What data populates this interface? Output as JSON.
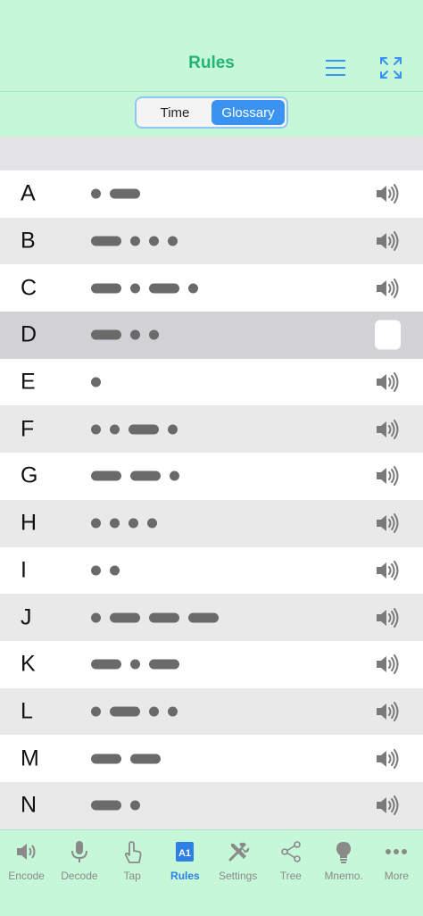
{
  "nav": {
    "title": "Rules"
  },
  "segments": {
    "time": "Time",
    "glossary": "Glossary",
    "selected": "Glossary"
  },
  "letters": [
    {
      "letter": "A",
      "code": ".-"
    },
    {
      "letter": "B",
      "code": "-..."
    },
    {
      "letter": "C",
      "code": "-.-."
    },
    {
      "letter": "D",
      "code": "-.."
    },
    {
      "letter": "E",
      "code": "."
    },
    {
      "letter": "F",
      "code": "..-."
    },
    {
      "letter": "G",
      "code": "--."
    },
    {
      "letter": "H",
      "code": "...."
    },
    {
      "letter": "I",
      "code": ".."
    },
    {
      "letter": "J",
      "code": ".---"
    },
    {
      "letter": "K",
      "code": "-.-"
    },
    {
      "letter": "L",
      "code": ".-.."
    },
    {
      "letter": "M",
      "code": "--"
    },
    {
      "letter": "N",
      "code": "-."
    }
  ],
  "selected_letter": "D",
  "tabs": [
    {
      "label": "Encode",
      "icon": "speaker-icon"
    },
    {
      "label": "Decode",
      "icon": "microphone-icon"
    },
    {
      "label": "Tap",
      "icon": "hand-tap-icon"
    },
    {
      "label": "Rules",
      "icon": "a1-icon",
      "active": true
    },
    {
      "label": "Settings",
      "icon": "tools-icon"
    },
    {
      "label": "Tree",
      "icon": "share-tree-icon"
    },
    {
      "label": "Mnemo.",
      "icon": "lightbulb-icon"
    },
    {
      "label": "More",
      "icon": "more-dots-icon"
    }
  ],
  "colors": {
    "header_bg": "#c6f7d9",
    "title_green": "#25b573",
    "accent_blue": "#3a93f0",
    "morse_grey": "#6a6a6a"
  }
}
